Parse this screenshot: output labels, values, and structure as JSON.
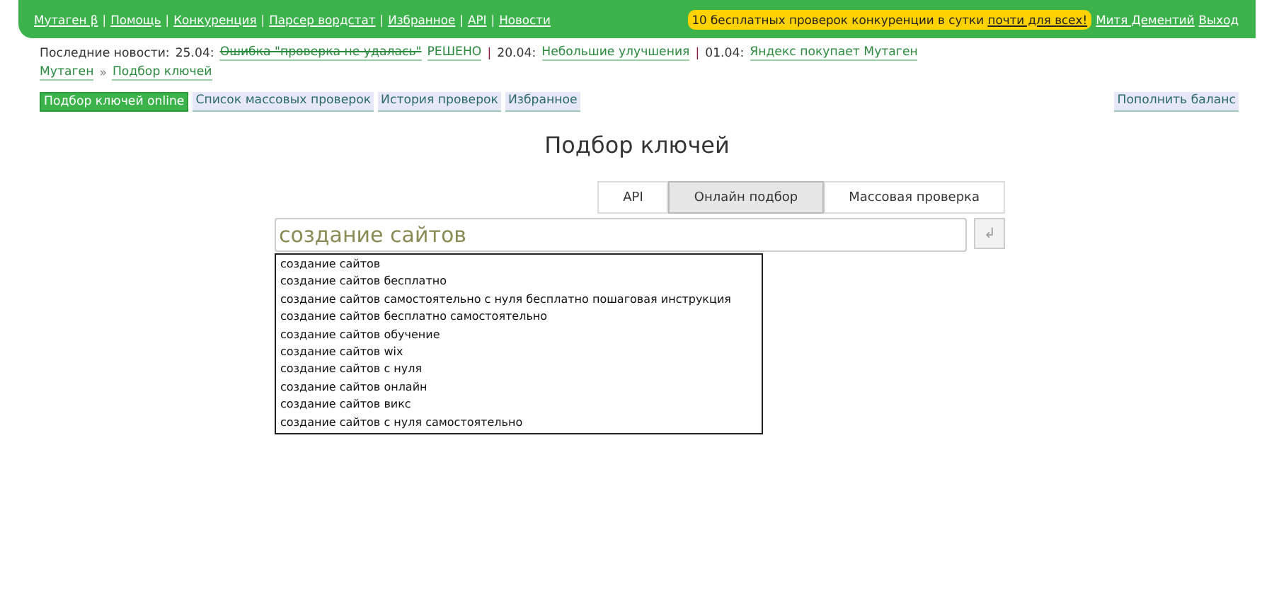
{
  "top_nav": {
    "links": [
      "Мутаген β",
      "Помощь",
      "Конкуренция",
      "Парсер вордстат",
      "Избранное",
      "API",
      "Новости"
    ],
    "promo": {
      "text": "10 бесплатных проверок конкуренции в сутки ",
      "link": "почти для всех!"
    },
    "user": "Митя Дементий",
    "logout": "Выход",
    "separator": "|"
  },
  "news": {
    "label": "Последние новости:",
    "separator": "|",
    "items": [
      {
        "date": "25.04:",
        "title": "Ошибка \"проверка не удалась\"",
        "struck": true,
        "suffix": "РЕШЕНО"
      },
      {
        "date": "20.04:",
        "title": "Небольшие улучшения",
        "struck": false
      },
      {
        "date": "01.04:",
        "title": "Яндекс покупает Мутаген",
        "struck": false
      }
    ]
  },
  "breadcrumbs": {
    "items": [
      "Мутаген",
      "Подбор ключей"
    ],
    "separator": "»"
  },
  "sub_nav": [
    {
      "label": "Подбор ключей online",
      "selected": true
    },
    {
      "label": "Список массовых проверок",
      "selected": false
    },
    {
      "label": "История проверок",
      "selected": false
    },
    {
      "label": "Избранное",
      "selected": false
    }
  ],
  "balance_button": "Пополнить баланс",
  "page_title": "Подбор ключей",
  "mode_tabs": [
    {
      "label": "API",
      "selected": false
    },
    {
      "label": "Онлайн подбор",
      "selected": true
    },
    {
      "label": "Массовая проверка",
      "selected": false
    }
  ],
  "search": {
    "value": "создание сайтов",
    "submit": "↲"
  },
  "suggestions": [
    "создание сайтов",
    "создание сайтов бесплатно",
    "создание сайтов самостоятельно с нуля бесплатно пошаговая инструкция",
    "создание сайтов бесплатно самостоятельно",
    "создание сайтов обучение",
    "создание сайтов wix",
    "создание сайтов с нуля",
    "создание сайтов онлайн",
    "создание сайтов викс",
    "создание сайтов с нуля самостоятельно"
  ]
}
